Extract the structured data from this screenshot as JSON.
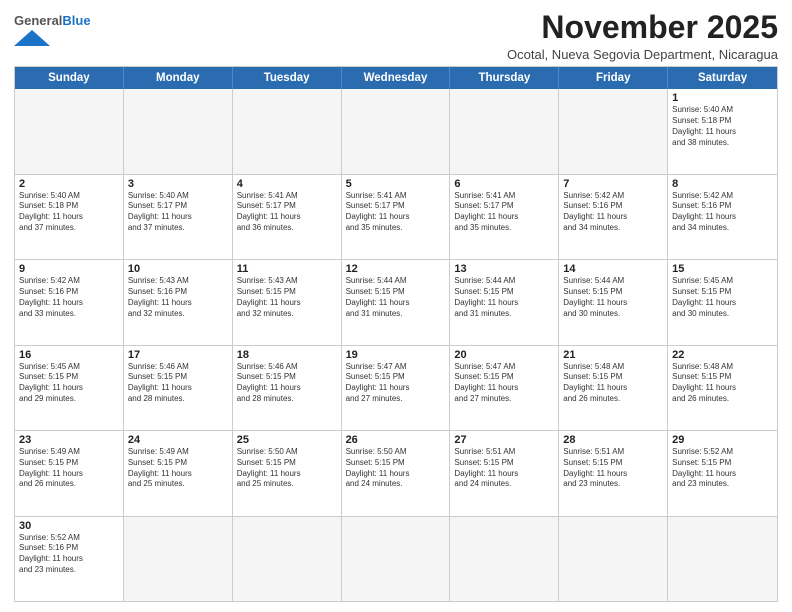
{
  "header": {
    "logo_line1": "General",
    "logo_line2": "Blue",
    "title": "November 2025",
    "subtitle": "Ocotal, Nueva Segovia Department, Nicaragua"
  },
  "days_of_week": [
    "Sunday",
    "Monday",
    "Tuesday",
    "Wednesday",
    "Thursday",
    "Friday",
    "Saturday"
  ],
  "rows": [
    [
      {
        "day": "",
        "text": "",
        "empty": true
      },
      {
        "day": "",
        "text": "",
        "empty": true
      },
      {
        "day": "",
        "text": "",
        "empty": true
      },
      {
        "day": "",
        "text": "",
        "empty": true
      },
      {
        "day": "",
        "text": "",
        "empty": true
      },
      {
        "day": "",
        "text": "",
        "empty": true
      },
      {
        "day": "1",
        "text": "Sunrise: 5:40 AM\nSunset: 5:18 PM\nDaylight: 11 hours\nand 38 minutes.",
        "empty": false
      }
    ],
    [
      {
        "day": "2",
        "text": "Sunrise: 5:40 AM\nSunset: 5:18 PM\nDaylight: 11 hours\nand 37 minutes.",
        "empty": false
      },
      {
        "day": "3",
        "text": "Sunrise: 5:40 AM\nSunset: 5:17 PM\nDaylight: 11 hours\nand 37 minutes.",
        "empty": false
      },
      {
        "day": "4",
        "text": "Sunrise: 5:41 AM\nSunset: 5:17 PM\nDaylight: 11 hours\nand 36 minutes.",
        "empty": false
      },
      {
        "day": "5",
        "text": "Sunrise: 5:41 AM\nSunset: 5:17 PM\nDaylight: 11 hours\nand 35 minutes.",
        "empty": false
      },
      {
        "day": "6",
        "text": "Sunrise: 5:41 AM\nSunset: 5:17 PM\nDaylight: 11 hours\nand 35 minutes.",
        "empty": false
      },
      {
        "day": "7",
        "text": "Sunrise: 5:42 AM\nSunset: 5:16 PM\nDaylight: 11 hours\nand 34 minutes.",
        "empty": false
      },
      {
        "day": "8",
        "text": "Sunrise: 5:42 AM\nSunset: 5:16 PM\nDaylight: 11 hours\nand 34 minutes.",
        "empty": false
      }
    ],
    [
      {
        "day": "9",
        "text": "Sunrise: 5:42 AM\nSunset: 5:16 PM\nDaylight: 11 hours\nand 33 minutes.",
        "empty": false
      },
      {
        "day": "10",
        "text": "Sunrise: 5:43 AM\nSunset: 5:16 PM\nDaylight: 11 hours\nand 32 minutes.",
        "empty": false
      },
      {
        "day": "11",
        "text": "Sunrise: 5:43 AM\nSunset: 5:15 PM\nDaylight: 11 hours\nand 32 minutes.",
        "empty": false
      },
      {
        "day": "12",
        "text": "Sunrise: 5:44 AM\nSunset: 5:15 PM\nDaylight: 11 hours\nand 31 minutes.",
        "empty": false
      },
      {
        "day": "13",
        "text": "Sunrise: 5:44 AM\nSunset: 5:15 PM\nDaylight: 11 hours\nand 31 minutes.",
        "empty": false
      },
      {
        "day": "14",
        "text": "Sunrise: 5:44 AM\nSunset: 5:15 PM\nDaylight: 11 hours\nand 30 minutes.",
        "empty": false
      },
      {
        "day": "15",
        "text": "Sunrise: 5:45 AM\nSunset: 5:15 PM\nDaylight: 11 hours\nand 30 minutes.",
        "empty": false
      }
    ],
    [
      {
        "day": "16",
        "text": "Sunrise: 5:45 AM\nSunset: 5:15 PM\nDaylight: 11 hours\nand 29 minutes.",
        "empty": false
      },
      {
        "day": "17",
        "text": "Sunrise: 5:46 AM\nSunset: 5:15 PM\nDaylight: 11 hours\nand 28 minutes.",
        "empty": false
      },
      {
        "day": "18",
        "text": "Sunrise: 5:46 AM\nSunset: 5:15 PM\nDaylight: 11 hours\nand 28 minutes.",
        "empty": false
      },
      {
        "day": "19",
        "text": "Sunrise: 5:47 AM\nSunset: 5:15 PM\nDaylight: 11 hours\nand 27 minutes.",
        "empty": false
      },
      {
        "day": "20",
        "text": "Sunrise: 5:47 AM\nSunset: 5:15 PM\nDaylight: 11 hours\nand 27 minutes.",
        "empty": false
      },
      {
        "day": "21",
        "text": "Sunrise: 5:48 AM\nSunset: 5:15 PM\nDaylight: 11 hours\nand 26 minutes.",
        "empty": false
      },
      {
        "day": "22",
        "text": "Sunrise: 5:48 AM\nSunset: 5:15 PM\nDaylight: 11 hours\nand 26 minutes.",
        "empty": false
      }
    ],
    [
      {
        "day": "23",
        "text": "Sunrise: 5:49 AM\nSunset: 5:15 PM\nDaylight: 11 hours\nand 26 minutes.",
        "empty": false
      },
      {
        "day": "24",
        "text": "Sunrise: 5:49 AM\nSunset: 5:15 PM\nDaylight: 11 hours\nand 25 minutes.",
        "empty": false
      },
      {
        "day": "25",
        "text": "Sunrise: 5:50 AM\nSunset: 5:15 PM\nDaylight: 11 hours\nand 25 minutes.",
        "empty": false
      },
      {
        "day": "26",
        "text": "Sunrise: 5:50 AM\nSunset: 5:15 PM\nDaylight: 11 hours\nand 24 minutes.",
        "empty": false
      },
      {
        "day": "27",
        "text": "Sunrise: 5:51 AM\nSunset: 5:15 PM\nDaylight: 11 hours\nand 24 minutes.",
        "empty": false
      },
      {
        "day": "28",
        "text": "Sunrise: 5:51 AM\nSunset: 5:15 PM\nDaylight: 11 hours\nand 23 minutes.",
        "empty": false
      },
      {
        "day": "29",
        "text": "Sunrise: 5:52 AM\nSunset: 5:15 PM\nDaylight: 11 hours\nand 23 minutes.",
        "empty": false
      }
    ],
    [
      {
        "day": "30",
        "text": "Sunrise: 5:52 AM\nSunset: 5:16 PM\nDaylight: 11 hours\nand 23 minutes.",
        "empty": false
      },
      {
        "day": "",
        "text": "",
        "empty": true
      },
      {
        "day": "",
        "text": "",
        "empty": true
      },
      {
        "day": "",
        "text": "",
        "empty": true
      },
      {
        "day": "",
        "text": "",
        "empty": true
      },
      {
        "day": "",
        "text": "",
        "empty": true
      },
      {
        "day": "",
        "text": "",
        "empty": true
      }
    ]
  ]
}
